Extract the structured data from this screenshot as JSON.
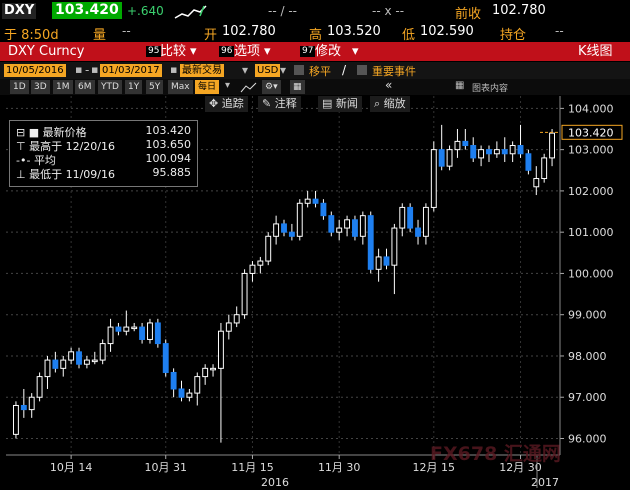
{
  "header": {
    "symbol": "DXY",
    "last_price": "103.420",
    "change": "+.640",
    "dash1": "-- / --",
    "dash2": "-- x --",
    "prev_close_label": "前收",
    "prev_close": "102.780",
    "time_label": "于 8:50d",
    "volume_label": "量",
    "volume_value": "--",
    "open_label": "开",
    "open_value": "102.780",
    "high_label": "高",
    "high_value": "103.520",
    "low_label": "低",
    "low_value": "102.590",
    "position_label": "持仓",
    "position_value": "--"
  },
  "menu": {
    "ticker": "DXY Curncy",
    "compare_num": "95",
    "compare": "比较",
    "options_num": "96",
    "options": "选项",
    "edit_num": "97",
    "edit": "修改",
    "chart_type": "K线图"
  },
  "toolbar": {
    "start_date": "10/05/2016",
    "end_date": "01/03/2017",
    "trade_mode": "最新交易",
    "currency": "USD",
    "move_avg": "移平",
    "events": "重要事件",
    "chart_content": "图表内容"
  },
  "timeframes": [
    "1D",
    "3D",
    "1M",
    "6M",
    "YTD",
    "1Y",
    "5Y",
    "Max"
  ],
  "interval": "每日",
  "tools": {
    "track": "追踪",
    "annotate": "注释",
    "news": "新闻",
    "zoom": "缩放"
  },
  "legend": {
    "last_label": "最新价格",
    "last_value": "103.420",
    "high_label": "最高于 12/20/16",
    "high_value": "103.650",
    "avg_label": "平均",
    "avg_value": "100.094",
    "low_label": "最低于 11/09/16",
    "low_value": "95.885"
  },
  "watermark": "FX678 汇通网",
  "chart_data": {
    "type": "candlestick",
    "ylim": [
      95.6,
      104.3
    ],
    "yticks": [
      "104.000",
      "103.000",
      "102.000",
      "101.000",
      "100.000",
      "99.000",
      "98.000",
      "97.000",
      "96.000"
    ],
    "last_price_tag": "103.420",
    "xticks": [
      "10月 14",
      "10月 31",
      "11月 15",
      "11月 30",
      "12月 15",
      "12月 30"
    ],
    "year_labels": [
      "2016",
      "2017"
    ],
    "candles": [
      [
        96.1,
        96.9,
        96.0,
        96.8
      ],
      [
        96.8,
        97.2,
        96.5,
        96.7
      ],
      [
        96.7,
        97.1,
        96.5,
        97.0
      ],
      [
        97.0,
        97.6,
        96.9,
        97.5
      ],
      [
        97.5,
        98.0,
        97.2,
        97.9
      ],
      [
        97.9,
        98.1,
        97.6,
        97.7
      ],
      [
        97.7,
        98.0,
        97.5,
        97.9
      ],
      [
        97.9,
        98.2,
        97.8,
        98.1
      ],
      [
        98.1,
        98.2,
        97.7,
        97.8
      ],
      [
        97.8,
        98.0,
        97.7,
        97.9
      ],
      [
        97.9,
        98.1,
        97.8,
        97.9
      ],
      [
        97.9,
        98.4,
        97.8,
        98.3
      ],
      [
        98.3,
        98.9,
        98.1,
        98.7
      ],
      [
        98.7,
        98.8,
        98.5,
        98.6
      ],
      [
        98.6,
        99.1,
        98.5,
        98.7
      ],
      [
        98.7,
        98.8,
        98.6,
        98.7
      ],
      [
        98.7,
        98.8,
        98.3,
        98.4
      ],
      [
        98.4,
        98.9,
        98.3,
        98.8
      ],
      [
        98.8,
        98.9,
        98.2,
        98.3
      ],
      [
        98.3,
        98.4,
        97.5,
        97.6
      ],
      [
        97.6,
        97.7,
        97.0,
        97.2
      ],
      [
        97.2,
        97.4,
        96.9,
        97.0
      ],
      [
        97.0,
        97.2,
        96.9,
        97.1
      ],
      [
        97.1,
        97.6,
        96.8,
        97.5
      ],
      [
        97.5,
        97.8,
        97.3,
        97.7
      ],
      [
        97.7,
        97.8,
        97.5,
        97.7
      ],
      [
        97.7,
        98.8,
        95.9,
        98.6
      ],
      [
        98.6,
        99.0,
        98.4,
        98.8
      ],
      [
        98.8,
        99.2,
        98.7,
        99.0
      ],
      [
        99.0,
        100.1,
        98.9,
        100.0
      ],
      [
        100.0,
        100.3,
        99.8,
        100.2
      ],
      [
        100.2,
        100.4,
        100.0,
        100.3
      ],
      [
        100.3,
        101.0,
        100.2,
        100.9
      ],
      [
        100.9,
        101.4,
        100.7,
        101.2
      ],
      [
        101.2,
        101.3,
        100.9,
        101.0
      ],
      [
        101.0,
        101.2,
        100.8,
        100.9
      ],
      [
        100.9,
        101.8,
        100.8,
        101.7
      ],
      [
        101.7,
        102.0,
        101.6,
        101.8
      ],
      [
        101.8,
        102.0,
        101.6,
        101.7
      ],
      [
        101.7,
        101.8,
        101.3,
        101.4
      ],
      [
        101.4,
        101.5,
        100.9,
        101.0
      ],
      [
        101.0,
        101.3,
        100.8,
        101.1
      ],
      [
        101.1,
        101.4,
        100.9,
        101.3
      ],
      [
        101.3,
        101.4,
        100.8,
        100.9
      ],
      [
        100.9,
        101.5,
        100.7,
        101.4
      ],
      [
        101.4,
        101.5,
        100.0,
        100.1
      ],
      [
        100.1,
        100.6,
        99.8,
        100.4
      ],
      [
        100.4,
        100.6,
        100.1,
        100.2
      ],
      [
        100.2,
        101.2,
        99.5,
        101.1
      ],
      [
        101.1,
        101.7,
        100.9,
        101.6
      ],
      [
        101.6,
        101.7,
        101.0,
        101.1
      ],
      [
        101.1,
        101.3,
        100.7,
        100.9
      ],
      [
        100.9,
        101.7,
        100.7,
        101.6
      ],
      [
        101.6,
        103.2,
        101.5,
        103.0
      ],
      [
        103.0,
        103.6,
        102.5,
        102.6
      ],
      [
        102.6,
        103.1,
        102.5,
        103.0
      ],
      [
        103.0,
        103.5,
        102.8,
        103.2
      ],
      [
        103.2,
        103.5,
        103.0,
        103.1
      ],
      [
        103.1,
        103.3,
        102.7,
        102.8
      ],
      [
        102.8,
        103.1,
        102.6,
        103.0
      ],
      [
        103.0,
        103.1,
        102.7,
        102.9
      ],
      [
        102.9,
        103.2,
        102.8,
        103.0
      ],
      [
        103.0,
        103.3,
        102.7,
        102.9
      ],
      [
        102.9,
        103.2,
        102.7,
        103.1
      ],
      [
        103.1,
        103.6,
        102.8,
        102.9
      ],
      [
        102.9,
        103.0,
        102.4,
        102.5
      ],
      [
        102.1,
        102.6,
        101.9,
        102.3
      ],
      [
        102.3,
        102.9,
        102.2,
        102.8
      ],
      [
        102.8,
        103.5,
        102.6,
        103.4
      ]
    ]
  }
}
